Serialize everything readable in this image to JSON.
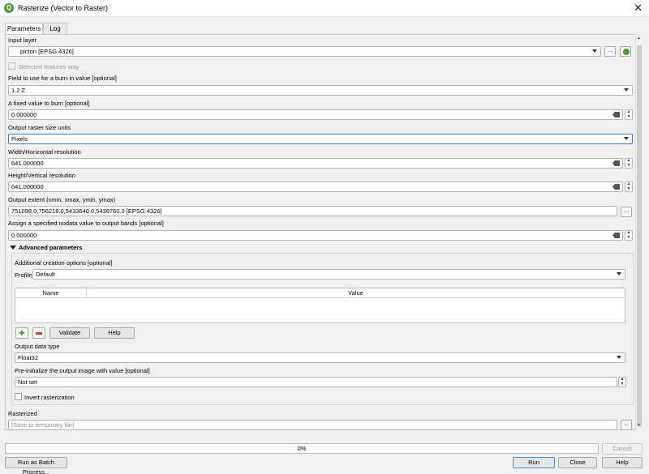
{
  "window": {
    "title": "Rasterize (Vector to Raster)",
    "close_glyph": "✕",
    "app_glyph": "Q"
  },
  "tabs": [
    {
      "label": "Parameters"
    },
    {
      "label": "Log"
    }
  ],
  "params": {
    "input_layer": {
      "label": "Input layer",
      "value": "picton [EPSG:4326]"
    },
    "selected_only": {
      "label": "Selected features only"
    },
    "burn_field": {
      "label": "Field to use for a burn-in value [optional]",
      "value": "1.2 Z"
    },
    "burn_value": {
      "label": "A fixed value to burn [optional]",
      "value": "0.000000"
    },
    "size_units": {
      "label": "Output raster size units",
      "value": "Pixels"
    },
    "width": {
      "label": "Width/Horizontal resolution",
      "value": "641.000000"
    },
    "height": {
      "label": "Height/Vertical resolution",
      "value": "641.000000"
    },
    "extent": {
      "label": "Output extent (xmin, xmax, ymin, ymax)",
      "value": "751098.0,756218.0,5433640.0,5438760.0 [EPSG:4326]"
    },
    "nodata": {
      "label": "Assign a specified nodata value to output bands [optional]",
      "value": "0.000000"
    },
    "advanced_header": "Advanced parameters",
    "creation_options": {
      "label": "Additional creation options [optional]",
      "profile_label": "Profile",
      "profile_value": "Default",
      "columns": [
        "Name",
        "Value"
      ],
      "validate": "Validate",
      "help": "Help"
    },
    "data_type": {
      "label": "Output data type",
      "value": "Float32"
    },
    "init_value": {
      "label": "Pre-initialize the output image with value [optional]",
      "value": "Not set"
    },
    "invert": {
      "label": "Invert rasterization"
    },
    "rasterized": {
      "label": "Rasterized",
      "placeholder": "[Save to temporary file]"
    },
    "browse_glyph": "..."
  },
  "footer": {
    "progress": "0%",
    "progress_value": 0,
    "cancel": "Cancel",
    "batch": "Run as Batch Process...",
    "run": "Run",
    "close": "Close",
    "help": "Help"
  }
}
